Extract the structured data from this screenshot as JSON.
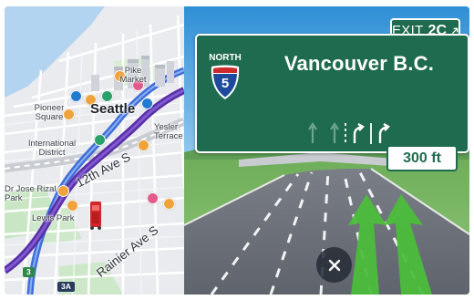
{
  "colors": {
    "sign_green": "#1f6b4f",
    "route_purple": "#5a2ea6",
    "route_blue": "#3f6fd9",
    "lane_green": "#4bbd3b",
    "interstate_blue": "#1d4a9c",
    "interstate_red": "#cc2b2b"
  },
  "map": {
    "city_label": "Seattle",
    "labels": {
      "pike_market": "Pike Market",
      "pioneer_square": "Pioneer Square",
      "international_district": "International District",
      "yesler_terrace": "Yesler Terrace",
      "jose_rizal_park": "Dr Jose Rizal Park",
      "lewis_park": "Lewis Park",
      "ave_12th": "12th Ave S",
      "rainier_ave": "Rainier Ave S"
    },
    "shields": {
      "route_3": "3",
      "route_3a": "3A"
    },
    "vehicle_icon": "red-vehicle-icon"
  },
  "guidance": {
    "exit_label": "EXIT",
    "exit_number": "2C",
    "exit_arrow_icon": "arrow-up-right-icon",
    "route_direction": "NORTH",
    "route_number": "5",
    "destination": "Vancouver B.C.",
    "distance": "300 ft",
    "lane_icons": [
      "lane-straight-icon",
      "lane-straight-icon",
      "lane-right-fork-icon",
      "lane-right-turn-icon"
    ]
  },
  "controls": {
    "close_icon": "close-icon"
  }
}
